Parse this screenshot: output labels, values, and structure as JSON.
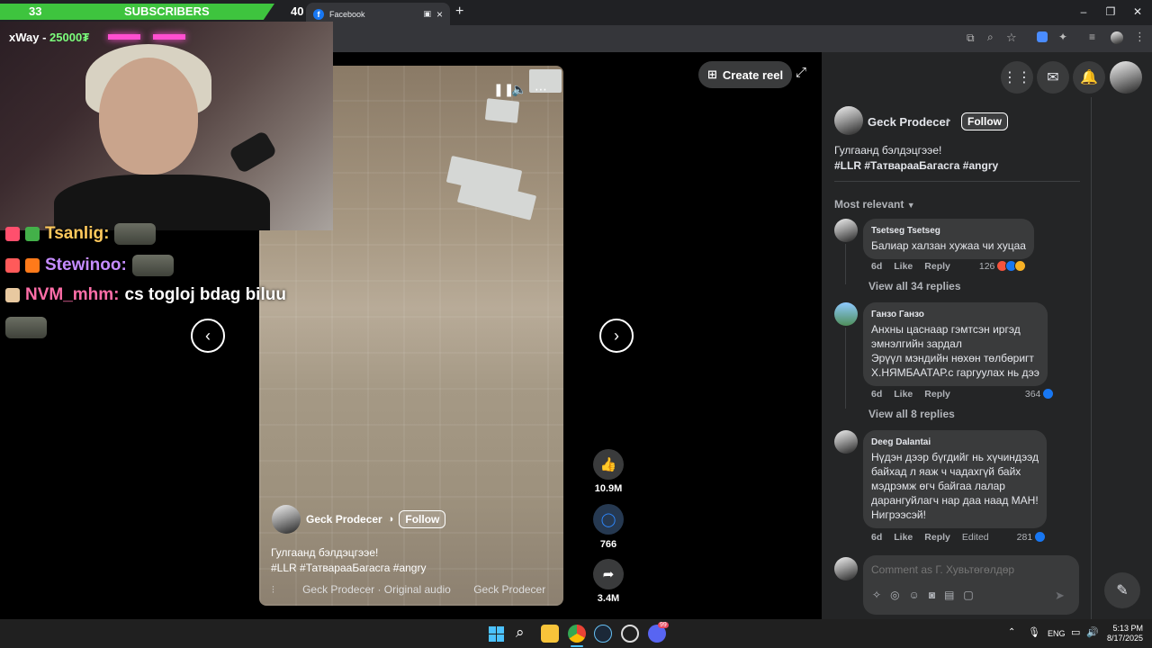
{
  "browser": {
    "tab_title": "Facebook",
    "tab_icon": "f",
    "new_tab": "+",
    "close_tab": "×",
    "window_controls": [
      "–",
      "❐",
      "✕"
    ]
  },
  "stream": {
    "sub_count_left": "33",
    "sub_label": "SUBSCRIBERS",
    "sub_count_right": "40",
    "donor_name": "xWay -",
    "donor_amount": "25000₮",
    "chat": [
      {
        "user": "Tsanlig:",
        "user_color": "#ffc95c",
        "message": ""
      },
      {
        "user": "Stewinoo:",
        "user_color": "#c58cff",
        "message": ""
      },
      {
        "user": "NVM_mhm:",
        "user_color": "#ff6ea8",
        "message": "cs togloj bdag biluu"
      }
    ]
  },
  "reel": {
    "author": "Geck Prodecer",
    "follow_label": "Follow",
    "caption_line1": "Гулгаанд бэлдэцгээе!",
    "caption_line2": "#LLR #ТатварааБагасга #angry",
    "audio": "Geck Prodecer · Original audio",
    "audio_tail": "Geck Prodecer",
    "likes": "10.9M",
    "comments": "766",
    "shares": "3.4M",
    "create_reel": "Create reel"
  },
  "panel": {
    "author": "Geck Prodecer",
    "follow_label": "Follow",
    "caption_line1": "Гулгаанд бэлдэцгээе!",
    "caption_line2": "#LLR #ТатварааБагасга #angry",
    "sort_label": "Most relevant",
    "comments": [
      {
        "name": "Tsetseg Tsetseg",
        "lines": [
          "Балиар халзан хужаа чи хуцаа"
        ],
        "time": "6d",
        "like": "Like",
        "reply": "Reply",
        "edited": "",
        "reactions": "126",
        "reaction_colors": [
          "#f5533d",
          "#1877f2",
          "#f7b125"
        ],
        "view_replies": "View all 34 replies"
      },
      {
        "name": "Гaнзо Ганзо",
        "lines": [
          "Анхны цаснаар гэмтсэн иргэд",
          "эмнэлгийн зардал",
          "Эрүүл мэндийн нөхөн төлбөригт",
          "Х.НЯМБААТАР.с гаргуулах нь дээ"
        ],
        "time": "6d",
        "like": "Like",
        "reply": "Reply",
        "edited": "",
        "reactions": "364",
        "reaction_colors": [
          "#1877f2"
        ],
        "view_replies": "View all 8 replies"
      },
      {
        "name": "Deeg Dalantai",
        "lines": [
          "Нүдэн дээр бүгдийг нь хүчиндээд",
          "байхад л яаж ч чадахгүй байх",
          "мэдрэмж өгч байгаа лалар",
          "дарангуйлагч нар даа наад МАН!",
          "Нигрээсэй!"
        ],
        "time": "6d",
        "like": "Like",
        "reply": "Reply",
        "edited": "Edited",
        "reactions": "281",
        "reaction_colors": [
          "#1877f2"
        ],
        "view_replies": ""
      }
    ],
    "comment_placeholder": "Comment as Г. Хувьтөгөлдөр"
  },
  "taskbar": {
    "lang": "ENG",
    "time": "5:13 PM",
    "date": "8/17/2025",
    "badge": "99"
  }
}
